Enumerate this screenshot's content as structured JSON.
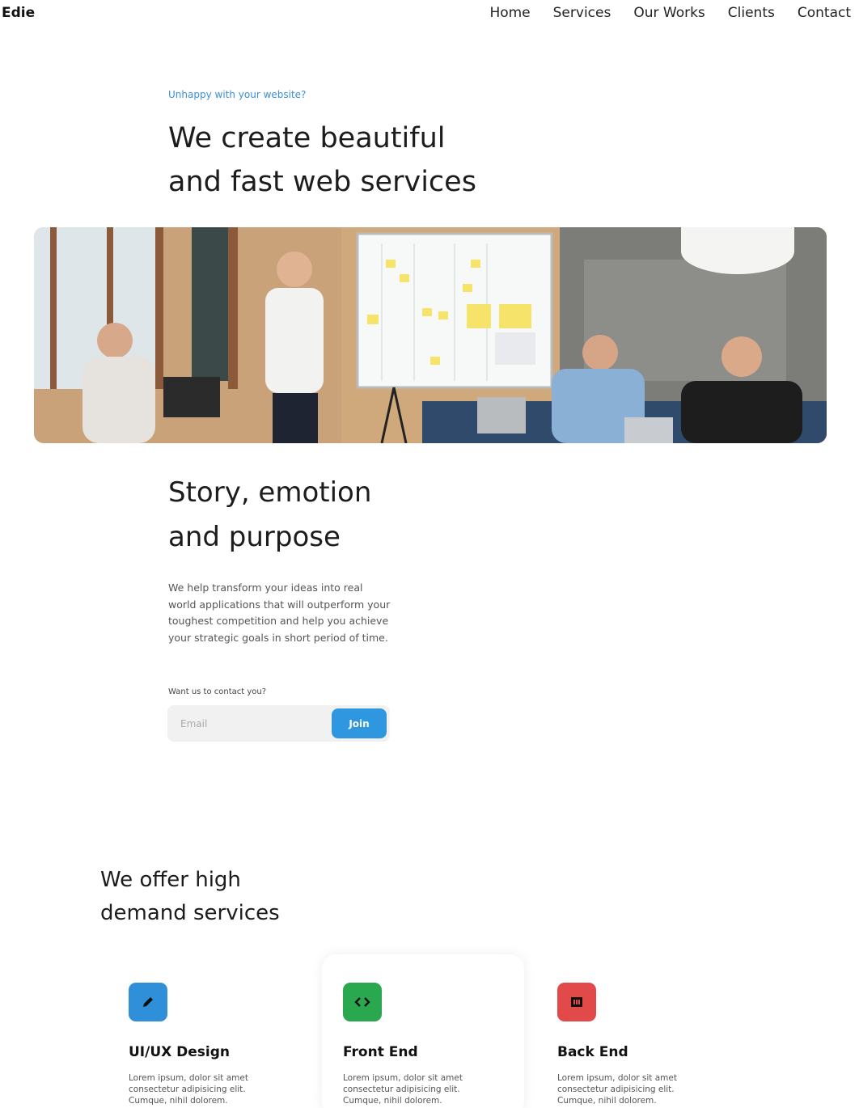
{
  "nav": {
    "brand": "Edie",
    "links": [
      "Home",
      "Services",
      "Our Works",
      "Clients",
      "Contact"
    ]
  },
  "hero": {
    "eyebrow": "Unhappy with your website?",
    "title_line1": "We create beautiful",
    "title_line2": "and fast web services"
  },
  "story": {
    "title_line1": "Story, emotion",
    "title_line2": "and purpose",
    "text": "We help transform your ideas into real world applications that will outperform your toughest competition and help you achieve your strategic goals in short period of time.",
    "cta_label": "Want us to contact you?",
    "email_placeholder": "Email",
    "join_label": "Join"
  },
  "services": {
    "title_line1": "We offer high",
    "title_line2": "demand services",
    "cards": [
      {
        "title": "UI/UX Design",
        "text": "Lorem ipsum, dolor sit amet consectetur adipisicing elit. Cumque, nihil dolorem.",
        "icon": "pencil-icon",
        "color": "#2f8fd8"
      },
      {
        "title": "Front End",
        "text": "Lorem ipsum, dolor sit amet consectetur adipisicing elit. Cumque, nihil dolorem.",
        "icon": "code-icon",
        "color": "#2aa84f"
      },
      {
        "title": "Back End",
        "text": "Lorem ipsum, dolor sit amet consectetur adipisicing elit. Cumque, nihil dolorem.",
        "icon": "server-icon",
        "color": "#e24a4a"
      }
    ]
  }
}
